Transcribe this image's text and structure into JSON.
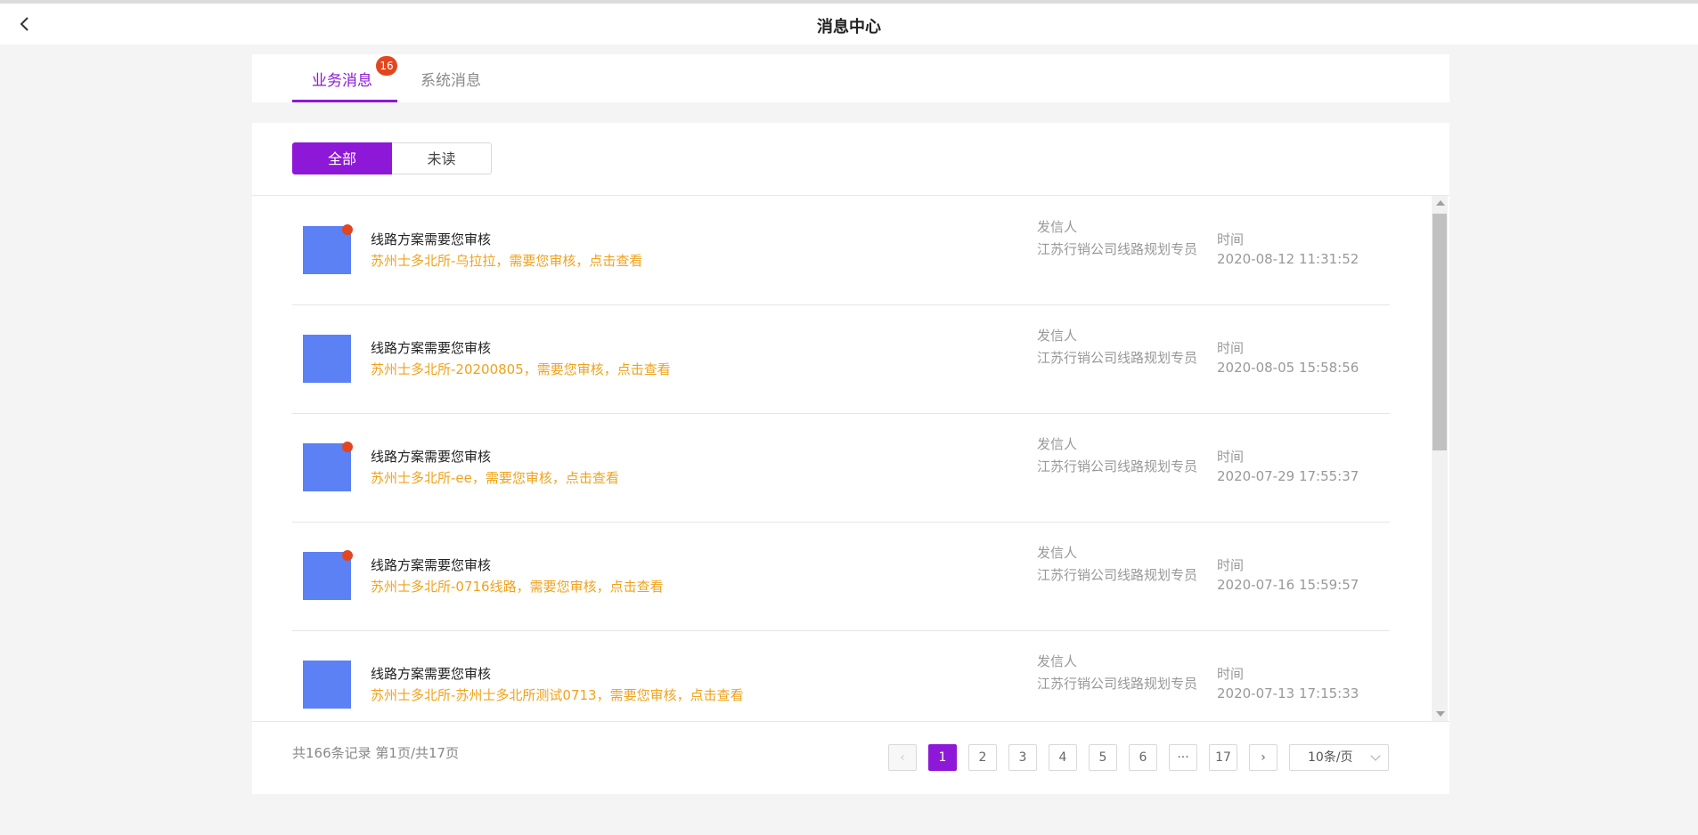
{
  "header": {
    "title": "消息中心",
    "back_icon": "chevron-left-icon"
  },
  "tabs": [
    {
      "label": "业务消息",
      "badge": "16",
      "active": true
    },
    {
      "label": "系统消息",
      "active": false
    }
  ],
  "filter": {
    "all": "全部",
    "unread": "未读",
    "selected": "全部"
  },
  "messages": [
    {
      "title": "线路方案需要您审核",
      "body": "苏州士多北所-乌拉拉，需要您审核，点击查看",
      "sender_label": "发信人",
      "sender": "江苏行销公司线路规划专员",
      "time_label": "时间",
      "time": "2020-08-12 11:31:52",
      "unread": true
    },
    {
      "title": "线路方案需要您审核",
      "body": "苏州士多北所-20200805，需要您审核，点击查看",
      "sender_label": "发信人",
      "sender": "江苏行销公司线路规划专员",
      "time_label": "时间",
      "time": "2020-08-05 15:58:56",
      "unread": false
    },
    {
      "title": "线路方案需要您审核",
      "body": "苏州士多北所-ee，需要您审核，点击查看",
      "sender_label": "发信人",
      "sender": "江苏行销公司线路规划专员",
      "time_label": "时间",
      "time": "2020-07-29 17:55:37",
      "unread": true
    },
    {
      "title": "线路方案需要您审核",
      "body": "苏州士多北所-0716线路，需要您审核，点击查看",
      "sender_label": "发信人",
      "sender": "江苏行销公司线路规划专员",
      "time_label": "时间",
      "time": "2020-07-16 15:59:57",
      "unread": true
    },
    {
      "title": "线路方案需要您审核",
      "body": "苏州士多北所-苏州士多北所测试0713，需要您审核，点击查看",
      "sender_label": "发信人",
      "sender": "江苏行销公司线路规划专员",
      "time_label": "时间",
      "time": "2020-07-13 17:15:33",
      "unread": false
    }
  ],
  "pagination": {
    "summary": "共166条记录 第1页/共17页",
    "prev": "‹",
    "next": "›",
    "pages": [
      "1",
      "2",
      "3",
      "4",
      "5",
      "6",
      "···",
      "17"
    ],
    "current": "1",
    "page_size": "10条/页"
  },
  "colors": {
    "accent": "#8d18d8",
    "badge": "#e3461e",
    "link": "#f0a21c",
    "avatar": "#5b81f5"
  }
}
